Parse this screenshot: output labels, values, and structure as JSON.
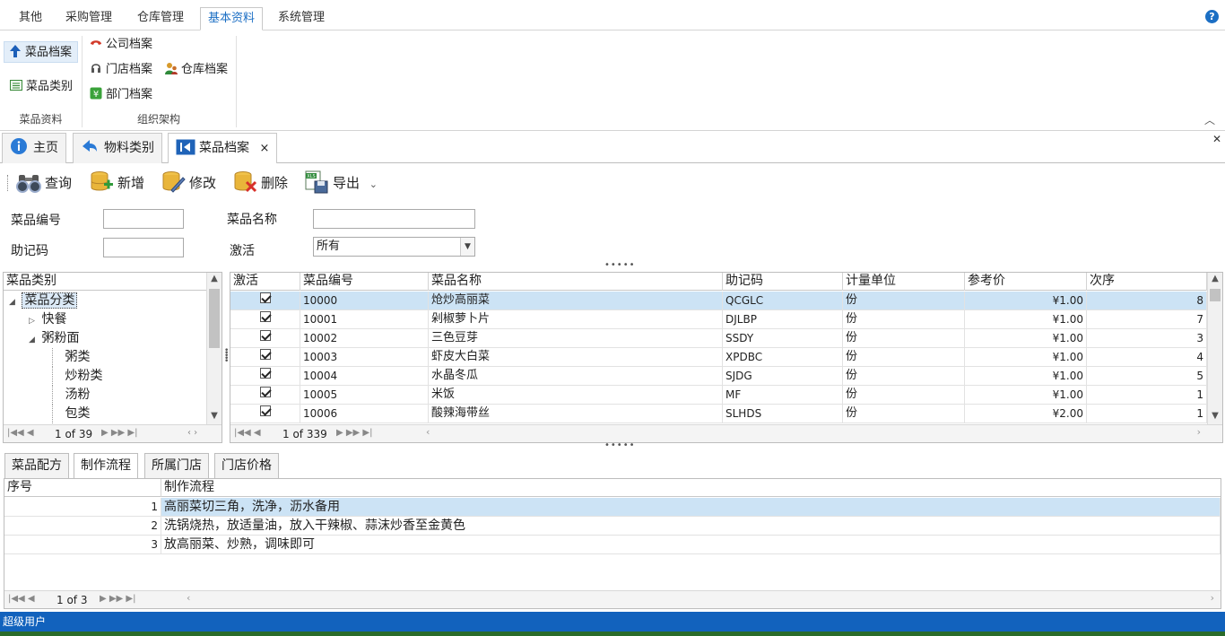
{
  "ribbon": {
    "tabs": [
      {
        "label": "其他"
      },
      {
        "label": "采购管理"
      },
      {
        "label": "仓库管理"
      },
      {
        "label": "基本资料"
      },
      {
        "label": "系统管理"
      }
    ],
    "help_label": "?",
    "groups": [
      {
        "label": "菜品资料",
        "items": [
          {
            "label": "菜品档案",
            "icon": "arrow-up-icon"
          },
          {
            "label": "菜品类别",
            "icon": "list-icon"
          }
        ]
      },
      {
        "label": "组织架构",
        "items": [
          {
            "label": "公司档案",
            "icon": "phone-icon"
          },
          {
            "label": "门店档案",
            "icon": "headset-icon"
          },
          {
            "label": "仓库档案",
            "icon": "users-icon"
          },
          {
            "label": "部门档案",
            "icon": "yen-icon"
          }
        ]
      }
    ]
  },
  "doc_tabs": [
    {
      "label": "主页",
      "icon": "info-icon"
    },
    {
      "label": "物料类别",
      "icon": "back-arrow-icon"
    },
    {
      "label": "菜品档案",
      "icon": "first-record-icon",
      "close": "×"
    }
  ],
  "toolbar": {
    "query": "查询",
    "add": "新增",
    "edit": "修改",
    "delete": "删除",
    "export": "导出"
  },
  "filters": {
    "code_label": "菜品编号",
    "code_value": "",
    "name_label": "菜品名称",
    "name_value": "",
    "mnemonic_label": "助记码",
    "mnemonic_value": "",
    "active_label": "激活",
    "active_value": "所有"
  },
  "category_tree": {
    "header": "菜品类别",
    "nodes": [
      {
        "label": "菜品分类",
        "level": 0,
        "expander": "◢"
      },
      {
        "label": "快餐",
        "level": 1,
        "expander": "▷"
      },
      {
        "label": "粥粉面",
        "level": 1,
        "expander": "◢"
      },
      {
        "label": "粥类",
        "level": 2,
        "expander": ""
      },
      {
        "label": "炒粉类",
        "level": 2,
        "expander": ""
      },
      {
        "label": "汤粉",
        "level": 2,
        "expander": ""
      },
      {
        "label": "包类",
        "level": 2,
        "expander": ""
      }
    ],
    "pager": "1 of 39"
  },
  "dish_grid": {
    "columns": [
      "激活",
      "菜品编号",
      "菜品名称",
      "助记码",
      "计量单位",
      "参考价",
      "次序"
    ],
    "rows": [
      {
        "active": true,
        "code": "10000",
        "name": "炝炒高丽菜",
        "mnemonic": "QCGLC",
        "unit": "份",
        "price": "¥1.00",
        "order": "8"
      },
      {
        "active": true,
        "code": "10001",
        "name": "剁椒萝卜片",
        "mnemonic": "DJLBP",
        "unit": "份",
        "price": "¥1.00",
        "order": "7"
      },
      {
        "active": true,
        "code": "10002",
        "name": "三色豆芽",
        "mnemonic": "SSDY",
        "unit": "份",
        "price": "¥1.00",
        "order": "3"
      },
      {
        "active": true,
        "code": "10003",
        "name": "虾皮大白菜",
        "mnemonic": "XPDBC",
        "unit": "份",
        "price": "¥1.00",
        "order": "4"
      },
      {
        "active": true,
        "code": "10004",
        "name": "水晶冬瓜",
        "mnemonic": "SJDG",
        "unit": "份",
        "price": "¥1.00",
        "order": "5"
      },
      {
        "active": true,
        "code": "10005",
        "name": "米饭",
        "mnemonic": "MF",
        "unit": "份",
        "price": "¥1.00",
        "order": "1"
      },
      {
        "active": true,
        "code": "10006",
        "name": "酸辣海带丝",
        "mnemonic": "SLHDS",
        "unit": "份",
        "price": "¥2.00",
        "order": "1"
      }
    ],
    "pager": "1 of 339"
  },
  "bottom_tabs": [
    {
      "label": "菜品配方"
    },
    {
      "label": "制作流程"
    },
    {
      "label": "所属门店"
    },
    {
      "label": "门店价格"
    }
  ],
  "process_grid": {
    "columns": [
      "序号",
      "制作流程"
    ],
    "rows": [
      {
        "seq": "1",
        "step": "高丽菜切三角，洗净，沥水备用"
      },
      {
        "seq": "2",
        "step": "洗锅烧热，放适量油，放入干辣椒、蒜沫炒香至金黄色"
      },
      {
        "seq": "3",
        "step": "放高丽菜、炒熟，调味即可"
      }
    ],
    "pager": "1 of 3"
  },
  "status": {
    "user": "超级用户"
  },
  "colors": {
    "accent": "#1c6fc4",
    "status_bar": "#1262bd",
    "selected_row": "#cce3f5"
  }
}
